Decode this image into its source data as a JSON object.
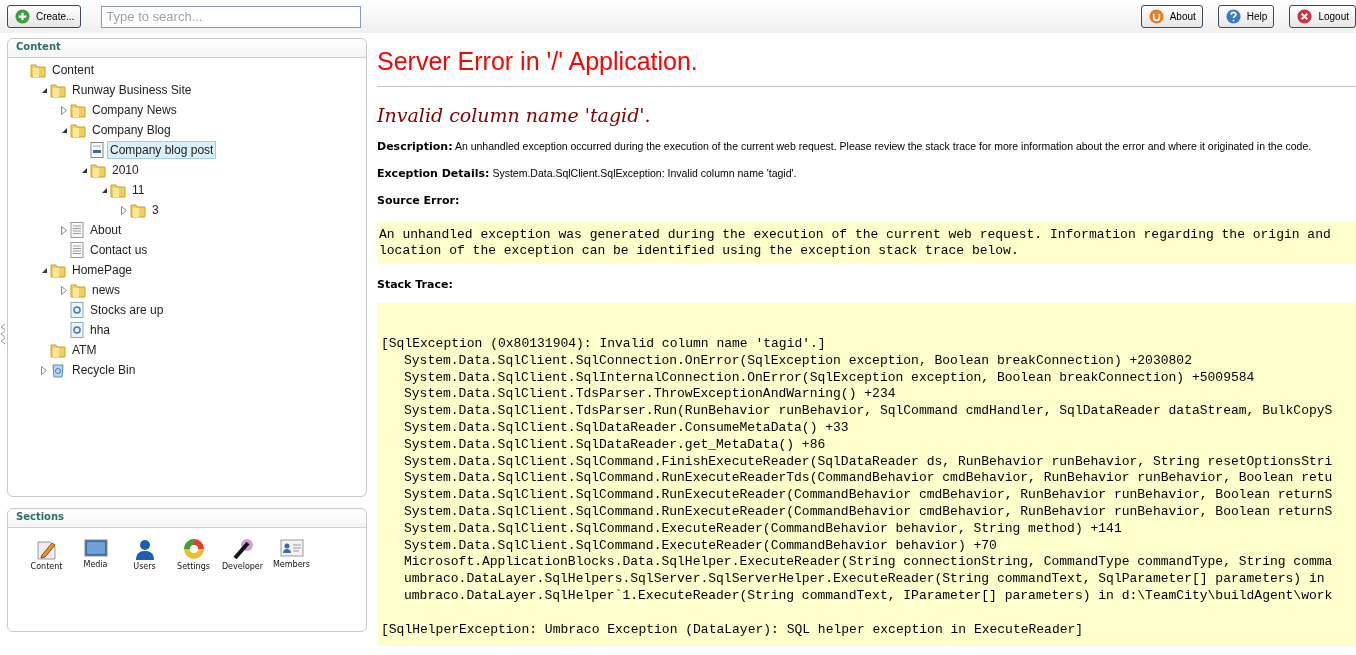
{
  "toolbar": {
    "create_button": "Create...",
    "search": {
      "placeholder": "Type to search..."
    },
    "buttons": [
      {
        "kind": "about",
        "label": "About"
      },
      {
        "kind": "help",
        "label": "Help"
      },
      {
        "kind": "logout",
        "label": "Logout"
      }
    ]
  },
  "content_panel": {
    "title": "Content",
    "tree": [
      {
        "label": "Content",
        "kind": "folder",
        "selected": false,
        "children": [
          {
            "label": "Runway Business Site",
            "kind": "folder",
            "expanded": true,
            "selected": false,
            "children": [
              {
                "label": "Company News",
                "kind": "folder",
                "expanded": false,
                "selected": false
              },
              {
                "label": "Company Blog",
                "kind": "folder",
                "expanded": true,
                "selected": false,
                "children": [
                  {
                    "label": "Company blog post",
                    "kind": "post",
                    "selected": true
                  },
                  {
                    "label": "2010",
                    "kind": "folder",
                    "expanded": true,
                    "selected": false,
                    "children": [
                      {
                        "label": "11",
                        "kind": "folder",
                        "expanded": true,
                        "selected": false,
                        "children": [
                          {
                            "label": "3",
                            "kind": "folder",
                            "expanded": false,
                            "selected": false
                          }
                        ]
                      }
                    ]
                  }
                ]
              },
              {
                "label": "About",
                "kind": "page",
                "expanded": false,
                "selected": false
              },
              {
                "label": "Contact us",
                "kind": "page",
                "selected": false
              }
            ]
          },
          {
            "label": "HomePage",
            "kind": "folder",
            "expanded": true,
            "selected": false,
            "children": [
              {
                "label": "news",
                "kind": "folder",
                "expanded": false,
                "selected": false
              },
              {
                "label": "Stocks are up",
                "kind": "item",
                "selected": false
              },
              {
                "label": "hha",
                "kind": "item",
                "selected": false
              }
            ]
          },
          {
            "label": "ATM",
            "kind": "folder",
            "selected": false
          },
          {
            "label": "Recycle Bin",
            "kind": "bin",
            "expanded": false,
            "selected": false
          }
        ]
      }
    ]
  },
  "sections_panel": {
    "title": "Sections",
    "items": [
      {
        "kind": "content",
        "label": "Content"
      },
      {
        "kind": "media",
        "label": "Media"
      },
      {
        "kind": "users",
        "label": "Users"
      },
      {
        "kind": "settings",
        "label": "Settings"
      },
      {
        "kind": "developer",
        "label": "Developer"
      },
      {
        "kind": "members",
        "label": "Members"
      }
    ]
  },
  "error_page": {
    "title": "Server Error in '/' Application.",
    "message": "Invalid column name 'tagid'.",
    "description": {
      "label": "Description:",
      "text": "An unhandled exception occurred during the execution of the current web request. Please review the stack trace for more information about the error and where it originated in the code."
    },
    "exception_details": {
      "label": "Exception Details:",
      "text": "System.Data.SqlClient.SqlException: Invalid column name 'tagid'."
    },
    "source_error": {
      "label": "Source Error:",
      "lines": [
        "An unhandled exception was generated during the execution of the current web request. Information regarding the origin and",
        "location of the exception can be identified using the exception stack trace below."
      ]
    },
    "stack_trace": {
      "label": "Stack Trace:",
      "groups": [
        [
          {
            "kind": "exception",
            "text": "[SqlException (0x80131904): Invalid column name 'tagid'.]"
          },
          {
            "kind": "frame",
            "text": "System.Data.SqlClient.SqlConnection.OnError(SqlException exception, Boolean breakConnection) +2030802"
          },
          {
            "kind": "frame",
            "text": "System.Data.SqlClient.SqlInternalConnection.OnError(SqlException exception, Boolean breakConnection) +5009584"
          },
          {
            "kind": "frame",
            "text": "System.Data.SqlClient.TdsParser.ThrowExceptionAndWarning() +234"
          },
          {
            "kind": "frame",
            "text": "System.Data.SqlClient.TdsParser.Run(RunBehavior runBehavior, SqlCommand cmdHandler, SqlDataReader dataStream, BulkCopyS"
          },
          {
            "kind": "frame",
            "text": "System.Data.SqlClient.SqlDataReader.ConsumeMetaData() +33"
          },
          {
            "kind": "frame",
            "text": "System.Data.SqlClient.SqlDataReader.get_MetaData() +86"
          },
          {
            "kind": "frame",
            "text": "System.Data.SqlClient.SqlCommand.FinishExecuteReader(SqlDataReader ds, RunBehavior runBehavior, String resetOptionsStri"
          },
          {
            "kind": "frame",
            "text": "System.Data.SqlClient.SqlCommand.RunExecuteReaderTds(CommandBehavior cmdBehavior, RunBehavior runBehavior, Boolean retu"
          },
          {
            "kind": "frame",
            "text": "System.Data.SqlClient.SqlCommand.RunExecuteReader(CommandBehavior cmdBehavior, RunBehavior runBehavior, Boolean returnS"
          },
          {
            "kind": "frame",
            "text": "System.Data.SqlClient.SqlCommand.RunExecuteReader(CommandBehavior cmdBehavior, RunBehavior runBehavior, Boolean returnS"
          },
          {
            "kind": "frame",
            "text": "System.Data.SqlClient.SqlCommand.ExecuteReader(CommandBehavior behavior, String method) +141"
          },
          {
            "kind": "frame",
            "text": "System.Data.SqlClient.SqlCommand.ExecuteReader(CommandBehavior behavior) +70"
          },
          {
            "kind": "frame",
            "text": "Microsoft.ApplicationBlocks.Data.SqlHelper.ExecuteReader(String connectionString, CommandType commandType, String comma"
          },
          {
            "kind": "frame",
            "text": "umbraco.DataLayer.SqlHelpers.SqlServer.SqlServerHelper.ExecuteReader(String commandText, SqlParameter[] parameters) in"
          },
          {
            "kind": "frame",
            "text": "umbraco.DataLayer.SqlHelper`1.ExecuteReader(String commandText, IParameter[] parameters) in d:\\TeamCity\\buildAgent\\work"
          }
        ],
        [
          {
            "kind": "exception",
            "text": "[SqlHelperException: Umbraco Exception (DataLayer): SQL helper exception in ExecuteReader]"
          }
        ]
      ]
    }
  }
}
